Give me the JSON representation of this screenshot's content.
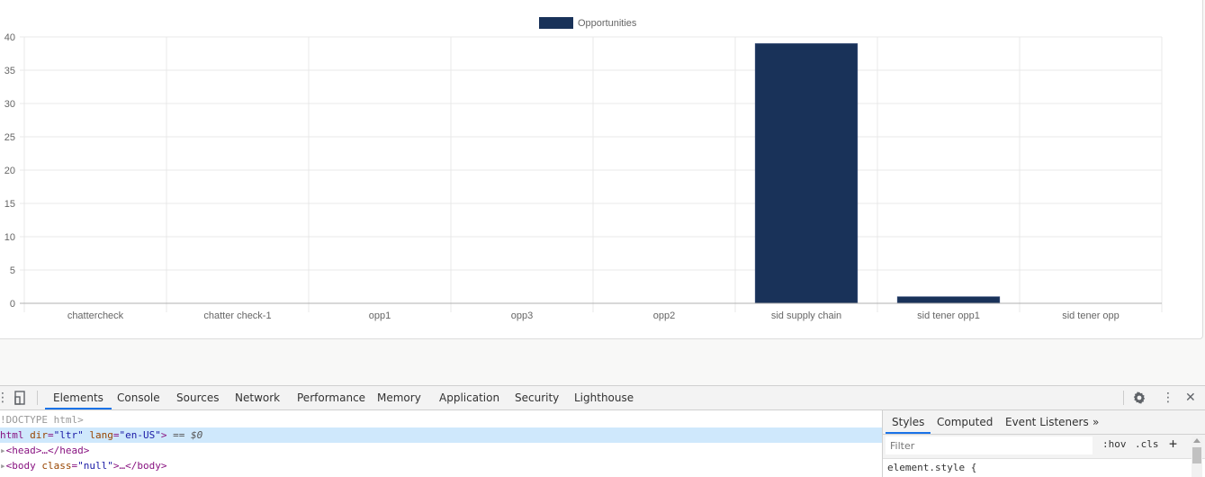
{
  "chart_data": {
    "type": "bar",
    "title": "",
    "xlabel": "",
    "ylabel": "",
    "categories": [
      "chattercheck",
      "chatter check-1",
      "opp1",
      "opp3",
      "opp2",
      "sid supply chain",
      "sid tener opp1",
      "sid tener opp"
    ],
    "series": [
      {
        "name": "Opportunities",
        "values": [
          0,
          0,
          0,
          0,
          0,
          39,
          1,
          0
        ],
        "color": "#193259"
      }
    ],
    "ylim": [
      0,
      40
    ],
    "yticks": [
      0,
      5,
      10,
      15,
      20,
      25,
      30,
      35,
      40
    ],
    "ytick_labels": [
      "0",
      "5",
      "10",
      "15",
      "20",
      "25",
      "30",
      "35",
      "40"
    ],
    "grid": true,
    "legend": {
      "position": "top-center",
      "entries": [
        "Opportunities"
      ]
    }
  },
  "devtools": {
    "toolbar": {
      "tabs": [
        "Elements",
        "Console",
        "Sources",
        "Network",
        "Performance",
        "Memory",
        "Application",
        "Security",
        "Lighthouse"
      ],
      "active_tab": "Elements",
      "icons": [
        "inspect-icon",
        "device-toggle-icon",
        "settings-icon",
        "more-icon",
        "close-icon"
      ]
    },
    "elements": {
      "doctype": "!DOCTYPE html>",
      "html_tag": "html",
      "html_attr1_name": "dir",
      "html_attr1_value": "\"ltr\"",
      "html_attr2_name": "lang",
      "html_attr2_value": "\"en-US\"",
      "selected_marker": "== $0",
      "head_line": "<head>…</head>",
      "body_open": "<body ",
      "body_attr_name": "class",
      "body_attr_value": "\"null\"",
      "body_close": ">…</body>"
    },
    "styles": {
      "tabs": [
        "Styles",
        "Computed",
        "Event Listeners"
      ],
      "active_tab": "Styles",
      "more_tabs": "»",
      "filter_placeholder": "Filter",
      "hov": ":hov",
      "cls": ".cls",
      "plus": "+",
      "element_style": "element.style {"
    }
  }
}
